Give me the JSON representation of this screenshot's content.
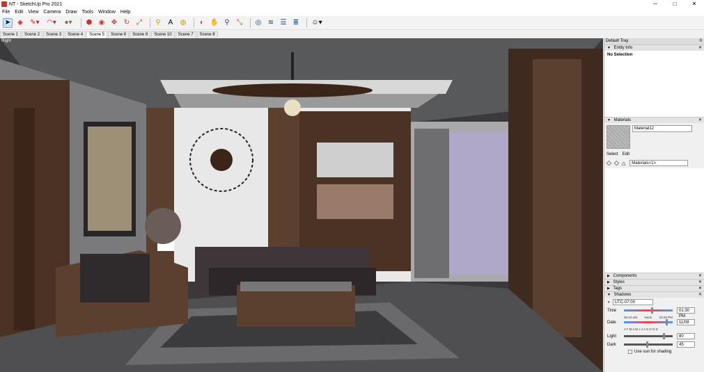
{
  "window": {
    "title": "NT - SketchUp Pro 2021",
    "min": "─",
    "max": "□",
    "close": "✕"
  },
  "menu": [
    "File",
    "Edit",
    "View",
    "Camera",
    "Draw",
    "Tools",
    "Window",
    "Help"
  ],
  "scenes": [
    "Scene 1",
    "Scene 2",
    "Scene 3",
    "Scene 4",
    "Scene 5",
    "Scene 6",
    "Scene 9",
    "Scene 10",
    "Scene 7",
    "Scene 8"
  ],
  "active_scene_index": 4,
  "viewport": {
    "label": "Right"
  },
  "tray": {
    "title": "Default Tray",
    "pin": "0",
    "entity_info": {
      "header": "Entity Info",
      "status": "No Selection"
    },
    "materials": {
      "header": "Materials",
      "name": "Material12",
      "tabs": [
        "Select",
        "Edit"
      ],
      "library": "Materials<1>"
    },
    "components": "Components",
    "styles": "Styles",
    "tags": "Tags",
    "shadows": {
      "header": "Shadows",
      "timezone": "UTC-07:00",
      "time_label": "Time",
      "time_start": "06:43 AM",
      "time_noon": "Noon",
      "time_end": "04:45 PM",
      "time_value": "01:30 PM",
      "date_label": "Date",
      "months": "J F M A M J J A S O N D",
      "date_value": "11/08",
      "light_label": "Light",
      "light_value": "80",
      "dark_label": "Dark",
      "dark_value": "45",
      "use_sun": "Use sun for shading"
    }
  }
}
